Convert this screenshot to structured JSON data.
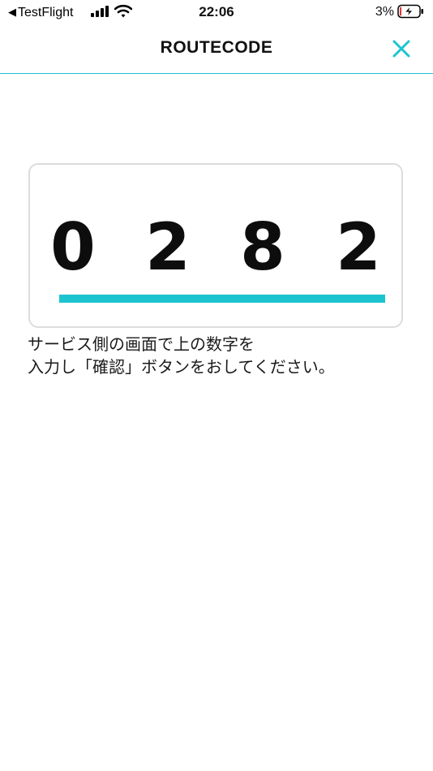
{
  "status_bar": {
    "back_label": "TestFlight",
    "time": "22:06",
    "battery_percent": "3%",
    "icons": [
      "back-arrow-icon",
      "signal-icon",
      "wifi-icon",
      "battery-charging-icon"
    ],
    "battery_level": 0.03,
    "battery_color": "#e53935"
  },
  "nav": {
    "title": "ROUTECODE",
    "close_icon": "close-icon",
    "accent_color": "#1cc4cf"
  },
  "code": {
    "digits": [
      "0",
      "2",
      "8",
      "2"
    ],
    "underline_color": "#1cc4cf"
  },
  "instruction": {
    "line1": "サービス側の画面で上の数字を",
    "line2": "入力し「確認」ボタンをおしてください。"
  }
}
